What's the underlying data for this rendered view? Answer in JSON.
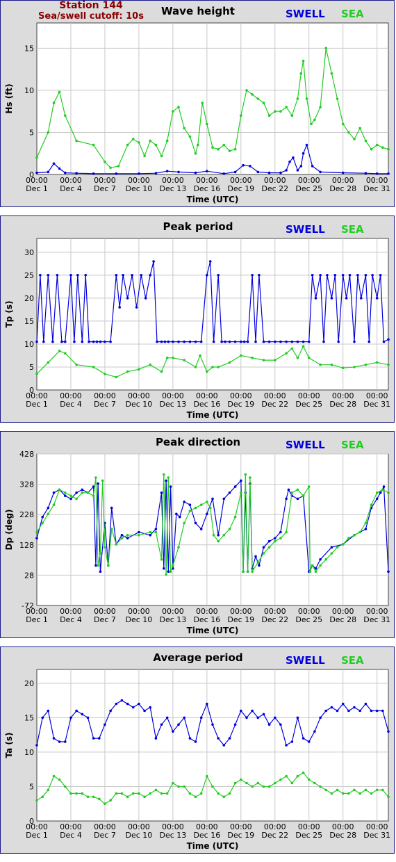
{
  "station": {
    "name": "Station 144",
    "cutoff": "Sea/swell cutoff: 10s"
  },
  "legend": {
    "swell": "SWELL",
    "sea": "SEA",
    "swell_color": "#0000dd",
    "sea_color": "#22cc22"
  },
  "x_labels": [
    {
      "time": "00:00",
      "date": "Dec 1"
    },
    {
      "time": "00:00",
      "date": "Dec 4"
    },
    {
      "time": "00:00",
      "date": "Dec 7"
    },
    {
      "time": "00:00",
      "date": "Dec 10"
    },
    {
      "time": "00:00",
      "date": "Dec 13"
    },
    {
      "time": "00:00",
      "date": "Dec 16"
    },
    {
      "time": "00:00",
      "date": "Dec 19"
    },
    {
      "time": "00:00",
      "date": "Dec 22"
    },
    {
      "time": "00:00",
      "date": "Dec 25"
    },
    {
      "time": "00:00",
      "date": "Dec 28"
    },
    {
      "time": "00:00",
      "date": "Dec 31"
    }
  ],
  "chart_data": [
    {
      "type": "line",
      "title": "Wave height",
      "xlabel": "Time (UTC)",
      "ylabel": "Hs (ft)",
      "xlim": [
        "Dec 1",
        "Jan 1"
      ],
      "ylim": [
        0,
        18
      ],
      "yticks": [
        0,
        5,
        10,
        15
      ],
      "grid": true,
      "legend_placement": "top-right",
      "series": [
        {
          "name": "SWELL",
          "color": "#0000dd",
          "x": [
            1,
            2,
            2.5,
            3,
            3.5,
            4.5,
            6,
            8,
            10,
            11.5,
            12.5,
            13.5,
            15,
            16,
            17.5,
            18.5,
            19.2,
            19.8,
            20.5,
            21.5,
            22.5,
            23,
            23.3,
            23.6,
            24,
            24.3,
            24.5,
            24.8,
            25.3,
            26,
            28,
            30,
            31,
            32
          ],
          "values": [
            0.2,
            0.3,
            1.3,
            0.7,
            0.2,
            0.15,
            0.1,
            0.1,
            0.1,
            0.15,
            0.4,
            0.3,
            0.2,
            0.4,
            0.1,
            0.3,
            1.1,
            1.0,
            0.3,
            0.2,
            0.2,
            0.5,
            1.5,
            2.0,
            0.5,
            1.0,
            2.5,
            3.5,
            1.0,
            0.3,
            0.2,
            0.15,
            0.1,
            0.1
          ]
        },
        {
          "name": "SEA",
          "color": "#22cc22",
          "x": [
            1,
            2,
            2.5,
            3,
            3.5,
            4.5,
            6,
            7,
            7.5,
            8.2,
            9,
            9.5,
            10,
            10.5,
            11,
            11.5,
            12,
            12.5,
            13,
            13.5,
            14,
            14.5,
            15,
            15.2,
            15.6,
            16,
            16.5,
            17,
            17.5,
            18,
            18.5,
            19,
            19.5,
            20,
            20.5,
            21,
            21.5,
            22,
            22.5,
            23,
            23.5,
            24,
            24.3,
            24.5,
            24.8,
            25.2,
            25.5,
            26,
            26.5,
            27,
            27.5,
            28,
            28.5,
            29,
            29.5,
            30,
            30.5,
            31,
            31.5,
            32
          ],
          "values": [
            2,
            5,
            8.5,
            9.8,
            7,
            4,
            3.5,
            1.5,
            0.8,
            1,
            3.5,
            4.2,
            3.8,
            2.2,
            4,
            3.5,
            2.2,
            4,
            7.5,
            8,
            5.5,
            4.5,
            2.5,
            3.5,
            8.5,
            6,
            3.2,
            3,
            3.5,
            2.8,
            3,
            7,
            10,
            9.5,
            9,
            8.5,
            7,
            7.5,
            7.5,
            8,
            7,
            9,
            12,
            13.5,
            9,
            6,
            6.5,
            8,
            15,
            12,
            9,
            6,
            5,
            4.2,
            5.5,
            4,
            3,
            3.5,
            3.2,
            3
          ]
        }
      ]
    },
    {
      "type": "line",
      "title": "Peak period",
      "xlabel": "Time (UTC)",
      "ylabel": "Tp (s)",
      "xlim": [
        "Dec 1",
        "Jan 1"
      ],
      "ylim": [
        0,
        33
      ],
      "yticks": [
        0,
        5,
        10,
        15,
        20,
        25,
        30
      ],
      "grid": true,
      "legend_placement": "top-right",
      "series": [
        {
          "name": "SWELL",
          "color": "#0000dd",
          "x": [
            1,
            1.3,
            1.6,
            2,
            2.4,
            2.8,
            3.2,
            3.5,
            4,
            4.3,
            4.6,
            5,
            5.3,
            5.6,
            6,
            6.3,
            6.6,
            7,
            7.5,
            8,
            8.3,
            8.6,
            9,
            9.4,
            9.8,
            10.2,
            10.6,
            11,
            11.3,
            11.6,
            12,
            12.3,
            12.6,
            13,
            13.5,
            14,
            14.5,
            15,
            15.5,
            16,
            16.3,
            16.6,
            17,
            17.3,
            17.6,
            18,
            18.5,
            19,
            19.3,
            19.6,
            20,
            20.3,
            20.6,
            21,
            21.5,
            22,
            22.5,
            23,
            23.5,
            24,
            24.5,
            25,
            25.3,
            25.6,
            26,
            26.3,
            26.6,
            27,
            27.3,
            27.6,
            28,
            28.3,
            28.6,
            29,
            29.3,
            29.6,
            30,
            30.3,
            30.6,
            31,
            31.3,
            31.6,
            32
          ],
          "values": [
            10.5,
            25,
            10.5,
            25,
            10.5,
            25,
            10.5,
            10.5,
            25,
            10.5,
            25,
            10.5,
            25,
            10.5,
            10.5,
            10.5,
            10.5,
            10.5,
            10.5,
            25,
            18,
            25,
            20,
            25,
            18,
            25,
            20,
            25,
            28,
            10.5,
            10.5,
            10.5,
            10.5,
            10.5,
            10.5,
            10.5,
            10.5,
            10.5,
            10.5,
            25,
            28,
            10.5,
            25,
            10.5,
            10.5,
            10.5,
            10.5,
            10.5,
            10.5,
            10.5,
            25,
            10.5,
            25,
            10.5,
            10.5,
            10.5,
            10.5,
            10.5,
            10.5,
            10.5,
            10.5,
            10.5,
            25,
            20,
            25,
            10.5,
            25,
            20,
            25,
            10.5,
            25,
            20,
            25,
            10.5,
            25,
            20,
            25,
            10.5,
            25,
            20,
            25,
            10.5,
            11
          ]
        },
        {
          "name": "SEA",
          "color": "#22cc22",
          "x": [
            1,
            2,
            3,
            3.5,
            4.5,
            6,
            7,
            8,
            9,
            10,
            11,
            12,
            12.5,
            13,
            14,
            15,
            15.4,
            16,
            16.5,
            17,
            18,
            19,
            20,
            21,
            22,
            23,
            23.5,
            24,
            24.5,
            25,
            26,
            27,
            28,
            29,
            30,
            31,
            32
          ],
          "values": [
            3.5,
            6,
            8.5,
            8,
            5.5,
            5,
            3.5,
            2.8,
            4,
            4.5,
            5.5,
            4,
            7,
            7,
            6.5,
            5,
            7.5,
            4,
            5,
            5,
            6,
            7.5,
            7,
            6.5,
            6.5,
            8,
            9,
            7,
            9.5,
            7,
            5.5,
            5.5,
            4.8,
            5,
            5.5,
            6,
            5.5
          ]
        }
      ]
    },
    {
      "type": "line",
      "title": "Peak direction",
      "xlabel": "Time (UTC)",
      "ylabel": "Dp (deg)",
      "xlim": [
        "Dec 1",
        "Jan 1"
      ],
      "ylim": [
        -72,
        428
      ],
      "yticks": [
        -72,
        28,
        128,
        228,
        328,
        428
      ],
      "grid": true,
      "legend_placement": "top-right",
      "series": [
        {
          "name": "SWELL",
          "color": "#0000dd",
          "x": [
            1,
            1.5,
            2,
            2.5,
            3,
            3.5,
            4,
            4.5,
            5,
            5.5,
            6,
            6.2,
            6.4,
            6.6,
            7,
            7.3,
            7.6,
            8,
            8.5,
            9,
            10,
            11,
            11.5,
            12,
            12.2,
            12.4,
            12.6,
            12.8,
            13,
            13.3,
            13.6,
            14,
            14.5,
            15,
            15.5,
            16,
            16.5,
            17,
            17.5,
            18,
            18.5,
            19,
            19.2,
            19.4,
            19.6,
            19.8,
            20,
            20.3,
            20.6,
            21,
            21.5,
            22,
            22.5,
            23,
            23.2,
            23.5,
            24,
            24.5,
            25,
            25.3,
            25.6,
            26,
            27,
            28,
            29,
            30,
            30.5,
            31,
            31.3,
            31.6,
            32
          ],
          "values": [
            150,
            220,
            250,
            300,
            310,
            290,
            280,
            300,
            310,
            300,
            320,
            60,
            330,
            40,
            200,
            60,
            250,
            130,
            160,
            150,
            170,
            160,
            180,
            300,
            50,
            340,
            40,
            320,
            50,
            230,
            220,
            270,
            260,
            200,
            180,
            230,
            280,
            160,
            280,
            300,
            320,
            340,
            40,
            300,
            40,
            330,
            50,
            90,
            60,
            120,
            140,
            150,
            170,
            280,
            310,
            290,
            280,
            290,
            40,
            60,
            50,
            80,
            120,
            130,
            160,
            180,
            250,
            280,
            300,
            320,
            40
          ]
        },
        {
          "name": "SEA",
          "color": "#22cc22",
          "x": [
            1,
            1.5,
            2,
            2.5,
            3,
            3.5,
            4,
            4.5,
            5,
            5.5,
            6,
            6.2,
            6.4,
            6.6,
            6.8,
            7,
            7.3,
            7.6,
            8,
            8.5,
            9,
            10,
            11,
            11.5,
            12,
            12.2,
            12.4,
            12.6,
            12.8,
            13,
            13.5,
            14,
            14.5,
            15,
            15.5,
            16,
            16.3,
            16.6,
            17,
            17.5,
            18,
            18.5,
            19,
            19.2,
            19.4,
            19.6,
            19.8,
            20,
            20.5,
            21,
            21.5,
            22,
            22.5,
            23,
            23.5,
            24,
            24.5,
            25,
            25.1,
            25.3,
            25.6,
            26,
            26.5,
            27,
            27.5,
            28,
            28.5,
            29,
            29.5,
            30,
            30.5,
            31,
            31.5,
            32
          ],
          "values": [
            170,
            200,
            230,
            260,
            310,
            300,
            290,
            280,
            300,
            300,
            290,
            350,
            60,
            100,
            340,
            120,
            60,
            180,
            130,
            150,
            160,
            160,
            170,
            170,
            80,
            360,
            30,
            350,
            40,
            60,
            120,
            200,
            240,
            250,
            260,
            270,
            250,
            160,
            140,
            160,
            180,
            220,
            300,
            40,
            360,
            40,
            350,
            40,
            70,
            100,
            120,
            140,
            150,
            170,
            300,
            310,
            290,
            320,
            40,
            60,
            40,
            60,
            80,
            100,
            120,
            130,
            150,
            160,
            170,
            200,
            260,
            300,
            310,
            300
          ]
        }
      ]
    },
    {
      "type": "line",
      "title": "Average period",
      "xlabel": "Time (UTC)",
      "ylabel": "Ta (s)",
      "xlim": [
        "Dec 1",
        "Jan 1"
      ],
      "ylim": [
        0,
        22
      ],
      "yticks": [
        0,
        5,
        10,
        15,
        20
      ],
      "grid": true,
      "legend_placement": "top-right",
      "series": [
        {
          "name": "SWELL",
          "color": "#0000dd",
          "x": [
            1,
            1.5,
            2,
            2.5,
            3,
            3.5,
            4,
            4.5,
            5,
            5.5,
            6,
            6.5,
            7,
            7.5,
            8,
            8.5,
            9,
            9.5,
            10,
            10.5,
            11,
            11.5,
            12,
            12.5,
            13,
            13.5,
            14,
            14.5,
            15,
            15.5,
            16,
            16.5,
            17,
            17.5,
            18,
            18.5,
            19,
            19.5,
            20,
            20.5,
            21,
            21.5,
            22,
            22.5,
            23,
            23.5,
            24,
            24.5,
            25,
            25.5,
            26,
            26.5,
            27,
            27.5,
            28,
            28.5,
            29,
            29.5,
            30,
            30.5,
            31,
            31.5,
            32
          ],
          "values": [
            11,
            15,
            16,
            12,
            11.5,
            11.5,
            15,
            16,
            15.5,
            15,
            12,
            12,
            14,
            16,
            17,
            17.5,
            17,
            16.5,
            17,
            16,
            16.5,
            12,
            14,
            15,
            13,
            14,
            15,
            12,
            11.5,
            15,
            17,
            14,
            12,
            11,
            12,
            14,
            16,
            15,
            16,
            15,
            15.5,
            14,
            15,
            14,
            11,
            11.5,
            15,
            12,
            11.5,
            13,
            15,
            16,
            16.5,
            16,
            17,
            16,
            16.5,
            16,
            17,
            16,
            16,
            16,
            13
          ]
        },
        {
          "name": "SEA",
          "color": "#22cc22",
          "x": [
            1,
            1.5,
            2,
            2.5,
            3,
            3.5,
            4,
            4.5,
            5,
            5.5,
            6,
            6.5,
            7,
            7.5,
            8,
            8.5,
            9,
            9.5,
            10,
            10.5,
            11,
            11.5,
            12,
            12.5,
            13,
            13.5,
            14,
            14.5,
            15,
            15.5,
            16,
            16.5,
            17,
            17.5,
            18,
            18.5,
            19,
            19.5,
            20,
            20.5,
            21,
            21.5,
            22,
            22.5,
            23,
            23.5,
            24,
            24.5,
            25,
            25.5,
            26,
            26.5,
            27,
            27.5,
            28,
            28.5,
            29,
            29.5,
            30,
            30.5,
            31,
            31.5,
            32
          ],
          "values": [
            3,
            3.5,
            4.5,
            6.5,
            6,
            5,
            4,
            4,
            4,
            3.5,
            3.5,
            3.2,
            2.5,
            3,
            4,
            4,
            3.5,
            4,
            4,
            3.5,
            4,
            4.5,
            4,
            4,
            5.5,
            5,
            5,
            4,
            3.5,
            4,
            6.5,
            5,
            4,
            3.5,
            4,
            5.5,
            6,
            5.5,
            5,
            5.5,
            5,
            5,
            5.5,
            6,
            6.5,
            5.5,
            6.5,
            7,
            6,
            5.5,
            5,
            4.5,
            4,
            4.5,
            4,
            4,
            4.5,
            4,
            4.5,
            4,
            4.5,
            4.5,
            3.5
          ]
        }
      ]
    }
  ]
}
